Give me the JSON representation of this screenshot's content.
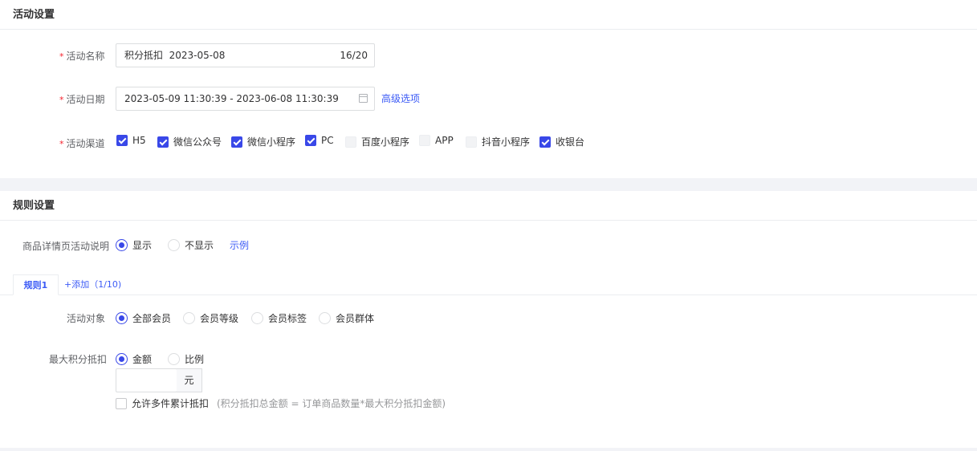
{
  "section_activity": {
    "title": "活动设置",
    "name": {
      "label": "活动名称",
      "value": "积分抵扣  2023-05-08",
      "count": "16/20"
    },
    "date": {
      "label": "活动日期",
      "value": "2023-05-09 11:30:39 - 2023-06-08 11:30:39",
      "advanced": "高级选项"
    },
    "channels": {
      "label": "活动渠道",
      "items": [
        {
          "label": "H5",
          "checked": true
        },
        {
          "label": "微信公众号",
          "checked": true
        },
        {
          "label": "微信小程序",
          "checked": true
        },
        {
          "label": "PC",
          "checked": true
        },
        {
          "label": "百度小程序",
          "checked": false
        },
        {
          "label": "APP",
          "checked": false
        },
        {
          "label": "抖音小程序",
          "checked": false
        },
        {
          "label": "收银台",
          "checked": true
        }
      ]
    }
  },
  "section_rules": {
    "title": "规则设置",
    "detail_desc": {
      "label": "商品详情页活动说明",
      "options": [
        "显示",
        "不显示"
      ],
      "selected": "显示",
      "example": "示例"
    },
    "tabs": {
      "active": "规则1",
      "add": "+添加（1/10)"
    },
    "target": {
      "label": "活动对象",
      "options": [
        "全部会员",
        "会员等级",
        "会员标签",
        "会员群体"
      ],
      "selected": "全部会员"
    },
    "max_deduct": {
      "label": "最大积分抵扣",
      "options": [
        "金额",
        "比例"
      ],
      "selected": "金额",
      "input_value": "",
      "unit": "元",
      "cumulative": {
        "label": "允许多件累计抵扣",
        "checked": false,
        "hint": "(积分抵扣总金额 = 订单商品数量*最大积分抵扣金额)"
      }
    }
  },
  "colors": {
    "accent": "#3948e8",
    "link": "#3c5bf6",
    "required": "#f5222d",
    "background": "#f2f3f7"
  }
}
